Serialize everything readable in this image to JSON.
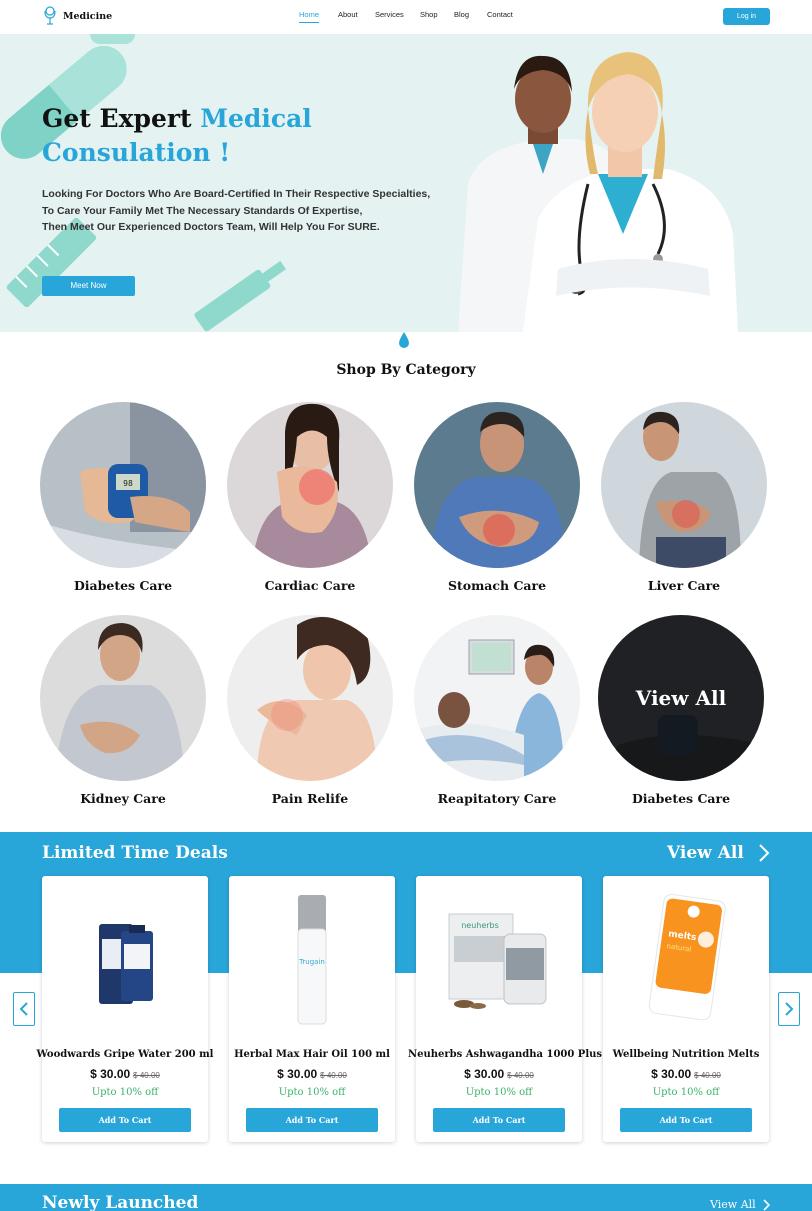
{
  "nav": {
    "brand": "Medicine",
    "items": [
      "Home",
      "About",
      "Services",
      "Shop",
      "Blog",
      "Contact"
    ],
    "active": "Home",
    "login_label": "Log in"
  },
  "hero": {
    "title_plain": "Get Expert",
    "title_accent_1": "Medical",
    "title_accent_2": "Consulation !",
    "desc_line1": "Looking For Doctors Who Are Board-Certified In Their Respective Specialties,",
    "desc_line2": "To Care Your Family Met The Necessary Standards Of Expertise,",
    "desc_line3": "Then Meet Our Experienced Doctors Team,  Will Help You For SURE.",
    "cta_label": "Meet Now"
  },
  "categories": {
    "title": "Shop By Category",
    "items": [
      {
        "label": "Diabetes Care"
      },
      {
        "label": "Cardiac Care"
      },
      {
        "label": "Stomach Care"
      },
      {
        "label": "Liver Care"
      },
      {
        "label": "Kidney Care"
      },
      {
        "label": "Pain Relife"
      },
      {
        "label": "Reapitatory Care"
      },
      {
        "label": "Diabetes Care",
        "overlay": "View All"
      }
    ]
  },
  "deals": {
    "title": "Limited Time Deals",
    "view_all": "View All",
    "products": [
      {
        "name": "Woodwards Gripe Water 200 ml",
        "price": "$ 30.00",
        "old_price": "$ 40.00",
        "discount": "Upto 10% off",
        "button": "Add To Cart"
      },
      {
        "name": "Herbal Max Hair Oil 100 ml",
        "price": "$ 30.00",
        "old_price": "$ 40.00",
        "discount": "Upto 10% off",
        "button": "Add To Cart"
      },
      {
        "name": "Neuherbs Ashwagandha 1000 Plus",
        "price": "$ 30.00",
        "old_price": "$ 40.00",
        "discount": "Upto 10% off",
        "button": "Add To Cart"
      },
      {
        "name": "Wellbeing Nutrition Melts",
        "price": "$ 30.00",
        "old_price": "$ 40.00",
        "discount": "Upto 10% off",
        "button": "Add To Cart"
      }
    ]
  },
  "newly": {
    "title": "Newly Launched",
    "view_all": "View All"
  },
  "colors": {
    "accent": "#29a6d9",
    "hero_bg": "#e4f3f1",
    "discount": "#3cb36a"
  }
}
